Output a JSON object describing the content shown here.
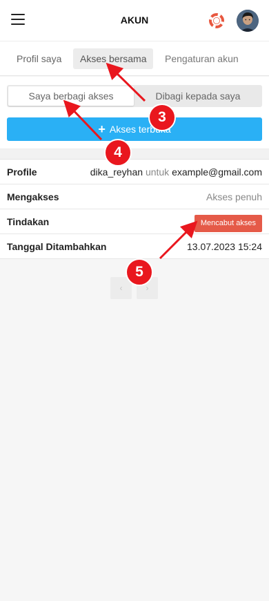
{
  "header": {
    "title": "AKUN",
    "menu_icon": "hamburger-menu-icon",
    "help_icon": "lifebuoy-icon",
    "avatar_icon": "user-avatar"
  },
  "tabs": [
    {
      "label": "Profil saya",
      "active": false
    },
    {
      "label": "Akses bersama",
      "active": true
    },
    {
      "label": "Pengaturan akun",
      "active": false
    }
  ],
  "subtabs": [
    {
      "label": "Saya berbagi akses",
      "active": true
    },
    {
      "label": "Dibagi kepada saya",
      "active": false
    }
  ],
  "add_button": {
    "label": "Akses terbuka",
    "icon": "plus-icon"
  },
  "details": {
    "profile_label": "Profile",
    "profile_user": "dika_reyhan",
    "profile_connector": "untuk",
    "profile_email": "example@gmail.com",
    "access_label": "Mengakses",
    "access_value": "Akses penuh",
    "action_label": "Tindakan",
    "revoke_button": "Mencabut akses",
    "date_label": "Tanggal Ditambahkan",
    "date_value": "13.07.2023 15:24"
  },
  "pager": {
    "prev": "‹",
    "next": "›"
  },
  "annotations": [
    {
      "number": "3"
    },
    {
      "number": "4"
    },
    {
      "number": "5"
    }
  ],
  "colors": {
    "primary": "#2ab0f5",
    "danger": "#e55a48",
    "annotation": "#e9171e"
  }
}
